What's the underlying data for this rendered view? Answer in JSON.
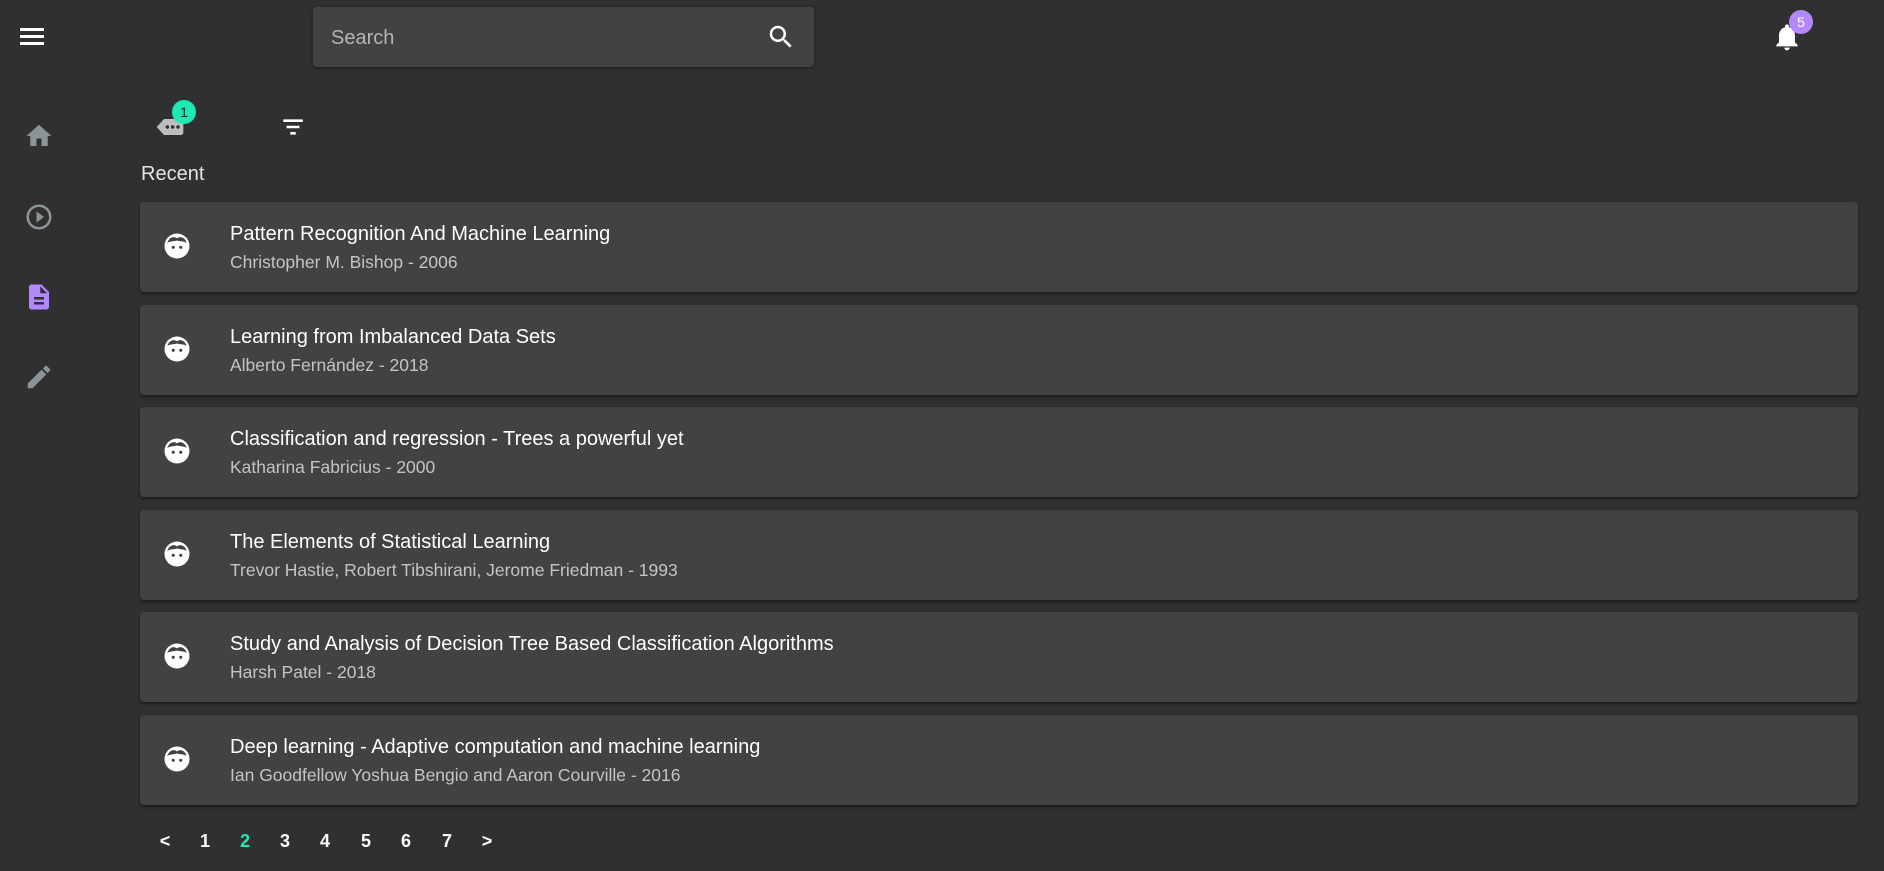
{
  "search": {
    "placeholder": "Search",
    "value": ""
  },
  "notifications": {
    "count": "5"
  },
  "sidebar": {
    "items": [
      {
        "icon": "home-icon",
        "active": false
      },
      {
        "icon": "play-circle-icon",
        "active": false
      },
      {
        "icon": "document-icon",
        "active": true
      },
      {
        "icon": "pencil-icon",
        "active": false
      }
    ]
  },
  "toolbar": {
    "chat_count": "1",
    "chat_icon": "chat-icon",
    "filter_icon": "filter-icon"
  },
  "section": {
    "title": "Recent"
  },
  "items": [
    {
      "title": "Pattern Recognition And Machine Learning",
      "subtitle": "Christopher M. Bishop - 2006"
    },
    {
      "title": "Learning from Imbalanced Data Sets",
      "subtitle": "Alberto Fernández - 2018"
    },
    {
      "title": "Classification and regression - Trees a powerful yet",
      "subtitle": "Katharina Fabricius - 2000"
    },
    {
      "title": "The Elements of Statistical Learning",
      "subtitle": "Trevor Hastie, Robert Tibshirani, Jerome Friedman - 1993"
    },
    {
      "title": "Study and Analysis of Decision Tree Based Classification Algorithms",
      "subtitle": "Harsh Patel - 2018"
    },
    {
      "title": "Deep learning - Adaptive computation and machine learning",
      "subtitle": "Ian Goodfellow Yoshua Bengio and Aaron Courville - 2016"
    }
  ],
  "pagination": {
    "prev": "<",
    "pages": [
      "1",
      "2",
      "3",
      "4",
      "5",
      "6",
      "7"
    ],
    "current": "2",
    "next": ">"
  },
  "colors": {
    "background": "#303030",
    "card": "#424242",
    "accent_teal": "#1de9b6",
    "accent_purple": "#b388ff",
    "sidebar_icon": "#8a9499"
  }
}
